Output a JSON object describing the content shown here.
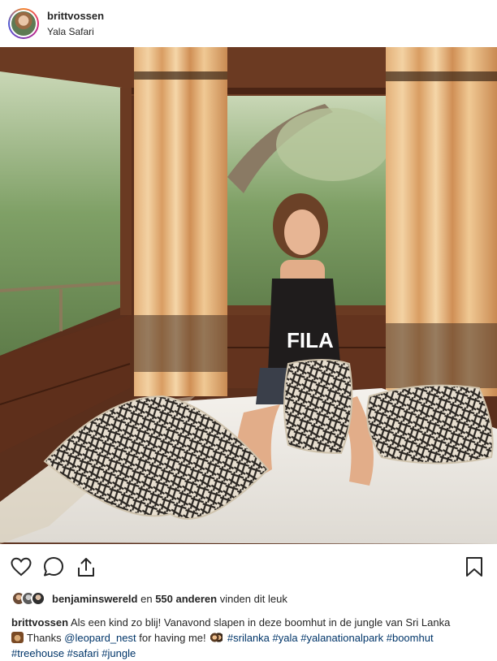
{
  "post": {
    "username": "brittvossen",
    "location": "Yala Safari"
  },
  "image": {
    "description_icon": "photo-treehouse-bedroom"
  },
  "actions": {
    "like_icon": "heart-icon",
    "comment_icon": "comment-icon",
    "share_icon": "share-icon",
    "save_icon": "bookmark-icon"
  },
  "likes": {
    "user": "benjaminswereld",
    "middle": "en",
    "count_text": "550 anderen",
    "suffix": "vinden dit leuk"
  },
  "caption": {
    "username": "brittvossen",
    "text1": "Als een kind zo blij! Vanavond slapen in deze boomhut in de jungle van Sri Lanka",
    "thanks": "Thanks",
    "mention": "@leopard_nest",
    "text2": "for having me!",
    "tags_line1": "#srilanka #yala #yalanationalpark #boomhut",
    "tags_line2": "#treehouse #safari #jungle"
  },
  "colors": {
    "text": "#262626",
    "link": "#003569",
    "wood": "#5a2f1c"
  }
}
